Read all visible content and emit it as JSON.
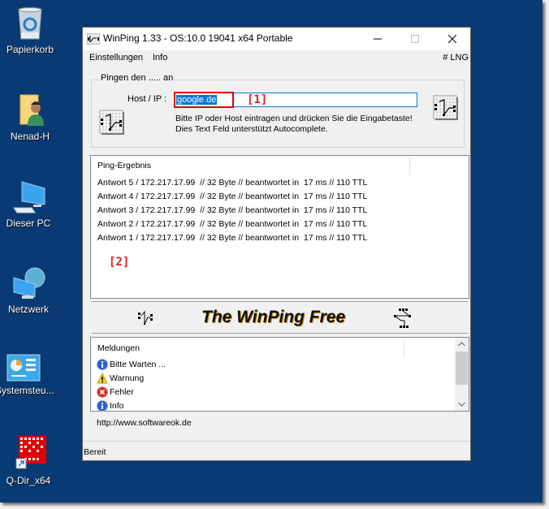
{
  "desktop": {
    "background": "#0a3a73",
    "icons": [
      {
        "label": "Papierkorb",
        "icon": "recycle-bin-icon"
      },
      {
        "label": "Nenad-H",
        "icon": "user-folder-icon"
      },
      {
        "label": "Dieser PC",
        "icon": "computer-icon"
      },
      {
        "label": "Netzwerk",
        "icon": "network-icon"
      },
      {
        "label": "Systemsteu...",
        "icon": "control-panel-icon"
      },
      {
        "label": "Q-Dir_x64",
        "icon": "qdir-shortcut-icon"
      }
    ]
  },
  "window": {
    "title": "WinPing 1.33 - OS:10.0 19041 x64 Portable",
    "controls": {
      "minimize": "—",
      "maximize": "☐",
      "close": "✕"
    },
    "menu": {
      "settings": "Einstellungen",
      "info": "Info",
      "language": "# LNG"
    },
    "ping_group": {
      "legend": "Pingen den ..... an",
      "host_label": "Host / IP :",
      "host_value": "google.de",
      "marker": "[1]",
      "hint_line1": "Bitte IP oder Host eintragen und drücken Sie die Eingabetaste!",
      "hint_line2": "Dies Text Feld unterstützt Autocomplete."
    },
    "results": {
      "header": "Ping-Ergebnis",
      "marker": "[2]",
      "lines": [
        "Antwort 5 / 172.217.17.99  // 32 Byte // beantwortet in  17 ms // 110 TTL",
        "Antwort 4 / 172.217.17.99  // 32 Byte // beantwortet in  17 ms // 110 TTL",
        "Antwort 3 / 172.217.17.99  // 32 Byte // beantwortet in  17 ms // 110 TTL",
        "Antwort 2 / 172.217.17.99  // 32 Byte // beantwortet in  17 ms // 110 TTL",
        "Antwort 1 / 172.217.17.99  // 32 Byte // beantwortet in  17 ms // 110 TTL"
      ]
    },
    "banner": {
      "text": "The WinPing Free"
    },
    "messages": {
      "header": "Meldungen",
      "items": [
        {
          "type": "info",
          "text": "Bitte Warten ..."
        },
        {
          "type": "warning",
          "text": "Warnung"
        },
        {
          "type": "error",
          "text": "Fehler"
        },
        {
          "type": "info",
          "text": "Info"
        }
      ]
    },
    "url": "http://www.softwareok.de",
    "status": "Bereit"
  }
}
